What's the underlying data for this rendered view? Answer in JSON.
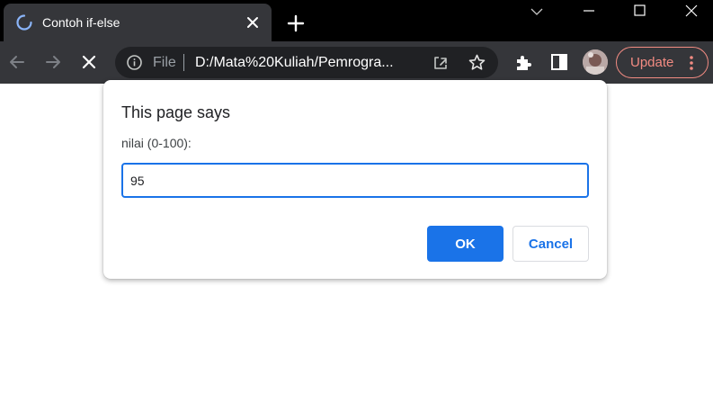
{
  "browser": {
    "tab": {
      "title": "Contoh if-else",
      "icon": "loading-spinner-icon"
    },
    "new_tab_icon": "plus-icon",
    "window_controls": [
      "chevron-down-icon",
      "minimize-icon",
      "maximize-icon",
      "close-icon"
    ],
    "toolbar": {
      "back_icon": "arrow-left-icon",
      "forward_icon": "arrow-right-icon",
      "stop_icon": "close-icon",
      "omnibox": {
        "info_icon": "info-icon",
        "scheme": "File",
        "url": "D:/Mata%20Kuliah/Pemrogra..."
      },
      "update_label": "Update"
    }
  },
  "dialog": {
    "title": "This page says",
    "message": "nilai (0-100):",
    "input_value": "95",
    "ok_label": "OK",
    "cancel_label": "Cancel"
  },
  "colors": {
    "accent": "#1a73e8",
    "update": "#f28b82",
    "toolbar_bg": "#35363a",
    "tabstrip_bg": "#000000"
  }
}
